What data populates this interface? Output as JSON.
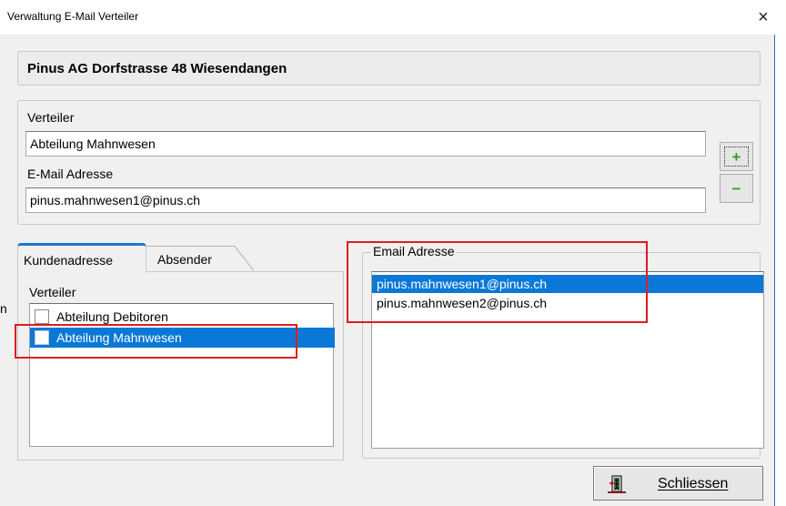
{
  "window": {
    "title": "Verwaltung E-Mail Verteiler",
    "close_glyph": "×"
  },
  "header": {
    "company": "Pinus AG Dorfstrasse 48 Wiesendangen"
  },
  "form": {
    "verteiler_label": "Verteiler",
    "verteiler_value": "Abteilung Mahnwesen",
    "email_label": "E-Mail Adresse",
    "email_value": "pinus.mahnwesen1@pinus.ch",
    "add_icon": "plus-icon",
    "remove_icon": "minus-icon",
    "add_glyph": "+",
    "remove_glyph": "−",
    "icon_color": "#3a9a2a"
  },
  "tabs": [
    {
      "label": "Kundenadresse",
      "active": true
    },
    {
      "label": "Absender",
      "active": false
    }
  ],
  "verteiler_panel": {
    "label": "Verteiler",
    "items": [
      {
        "label": "Abteilung Debitoren",
        "checked": false,
        "selected": false
      },
      {
        "label": "Abteilung Mahnwesen",
        "checked": false,
        "selected": true
      }
    ]
  },
  "email_group": {
    "legend": "Email Adresse",
    "items": [
      {
        "label": "pinus.mahnwesen1@pinus.ch",
        "selected": true
      },
      {
        "label": "pinus.mahnwesen2@pinus.ch",
        "selected": false
      }
    ]
  },
  "footer": {
    "close_button_label": "Schliessen",
    "close_button_icon": "exit-door-icon"
  },
  "stray_text": "n",
  "colors": {
    "selection": "#0a78d7",
    "tab_accent": "#1f77d0",
    "annotation_red": "#e11b22",
    "window_border": "#1a73c9"
  }
}
